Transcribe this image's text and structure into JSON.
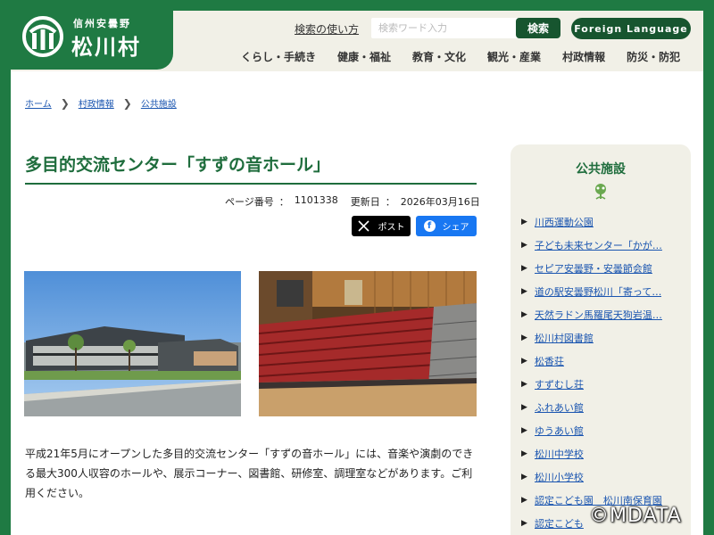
{
  "header": {
    "logo_sub": "信州安曇野",
    "logo_main": "松川村",
    "search_help": "検索の使い方",
    "search_placeholder": "検索ワード入力",
    "search_button": "検索",
    "language_button": "Foreign Language",
    "nav": [
      {
        "label": "くらし・手続き"
      },
      {
        "label": "健康・福祉"
      },
      {
        "label": "教育・文化"
      },
      {
        "label": "観光・産業"
      },
      {
        "label": "村政情報"
      },
      {
        "label": "防災・防犯"
      }
    ]
  },
  "breadcrumb": [
    {
      "label": "ホーム"
    },
    {
      "label": "村政情報"
    },
    {
      "label": "公共施設"
    }
  ],
  "page": {
    "title": "多目的交流センター「すずの音ホール」",
    "page_number_label": "ページ番号",
    "page_number": "1101338",
    "updated_label": "更新日",
    "updated": "2026年03月16日",
    "share_x": "ポスト",
    "share_fb": "シェア",
    "body": "平成21年5月にオープンした多目的交流センター「すずの音ホール」には、音楽や演劇のできる最大300人収容のホールや、展示コーナー、図書館、研修室、調理室などがあります。ご利用ください。"
  },
  "sidebar": {
    "title": "公共施設",
    "items": [
      {
        "label": "川西運動公園"
      },
      {
        "label": "子ども未来センター「かが…"
      },
      {
        "label": "セピア安曇野・安曇節会館"
      },
      {
        "label": "道の駅安曇野松川「寄って…"
      },
      {
        "label": "天然ラドン馬羅尾天狗岩温…"
      },
      {
        "label": "松川村図書館"
      },
      {
        "label": "松香荘"
      },
      {
        "label": "すずむし荘"
      },
      {
        "label": "ふれあい館"
      },
      {
        "label": "ゆうあい館"
      },
      {
        "label": "松川中学校"
      },
      {
        "label": "松川小学校"
      },
      {
        "label": "認定こども園　松川南保育園"
      },
      {
        "label": "認定こども"
      }
    ]
  },
  "watermark": "©MDATA",
  "colors": {
    "brand_green": "#1f7a43",
    "link": "#1a55b0"
  }
}
